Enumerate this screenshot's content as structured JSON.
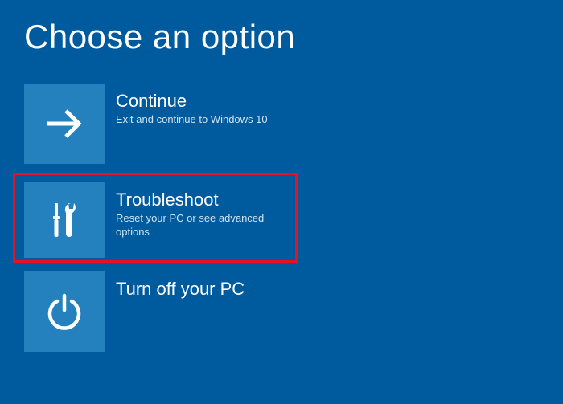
{
  "title": "Choose an option",
  "options": [
    {
      "title": "Continue",
      "subtitle": "Exit and continue to Windows 10",
      "icon": "arrow-right",
      "highlighted": false
    },
    {
      "title": "Troubleshoot",
      "subtitle": "Reset your PC or see advanced options",
      "icon": "tools",
      "highlighted": true
    },
    {
      "title": "Turn off your PC",
      "subtitle": "",
      "icon": "power",
      "highlighted": false
    }
  ],
  "colors": {
    "background": "#005a9e",
    "tile": "#2481bd",
    "highlight": "#e81123"
  }
}
